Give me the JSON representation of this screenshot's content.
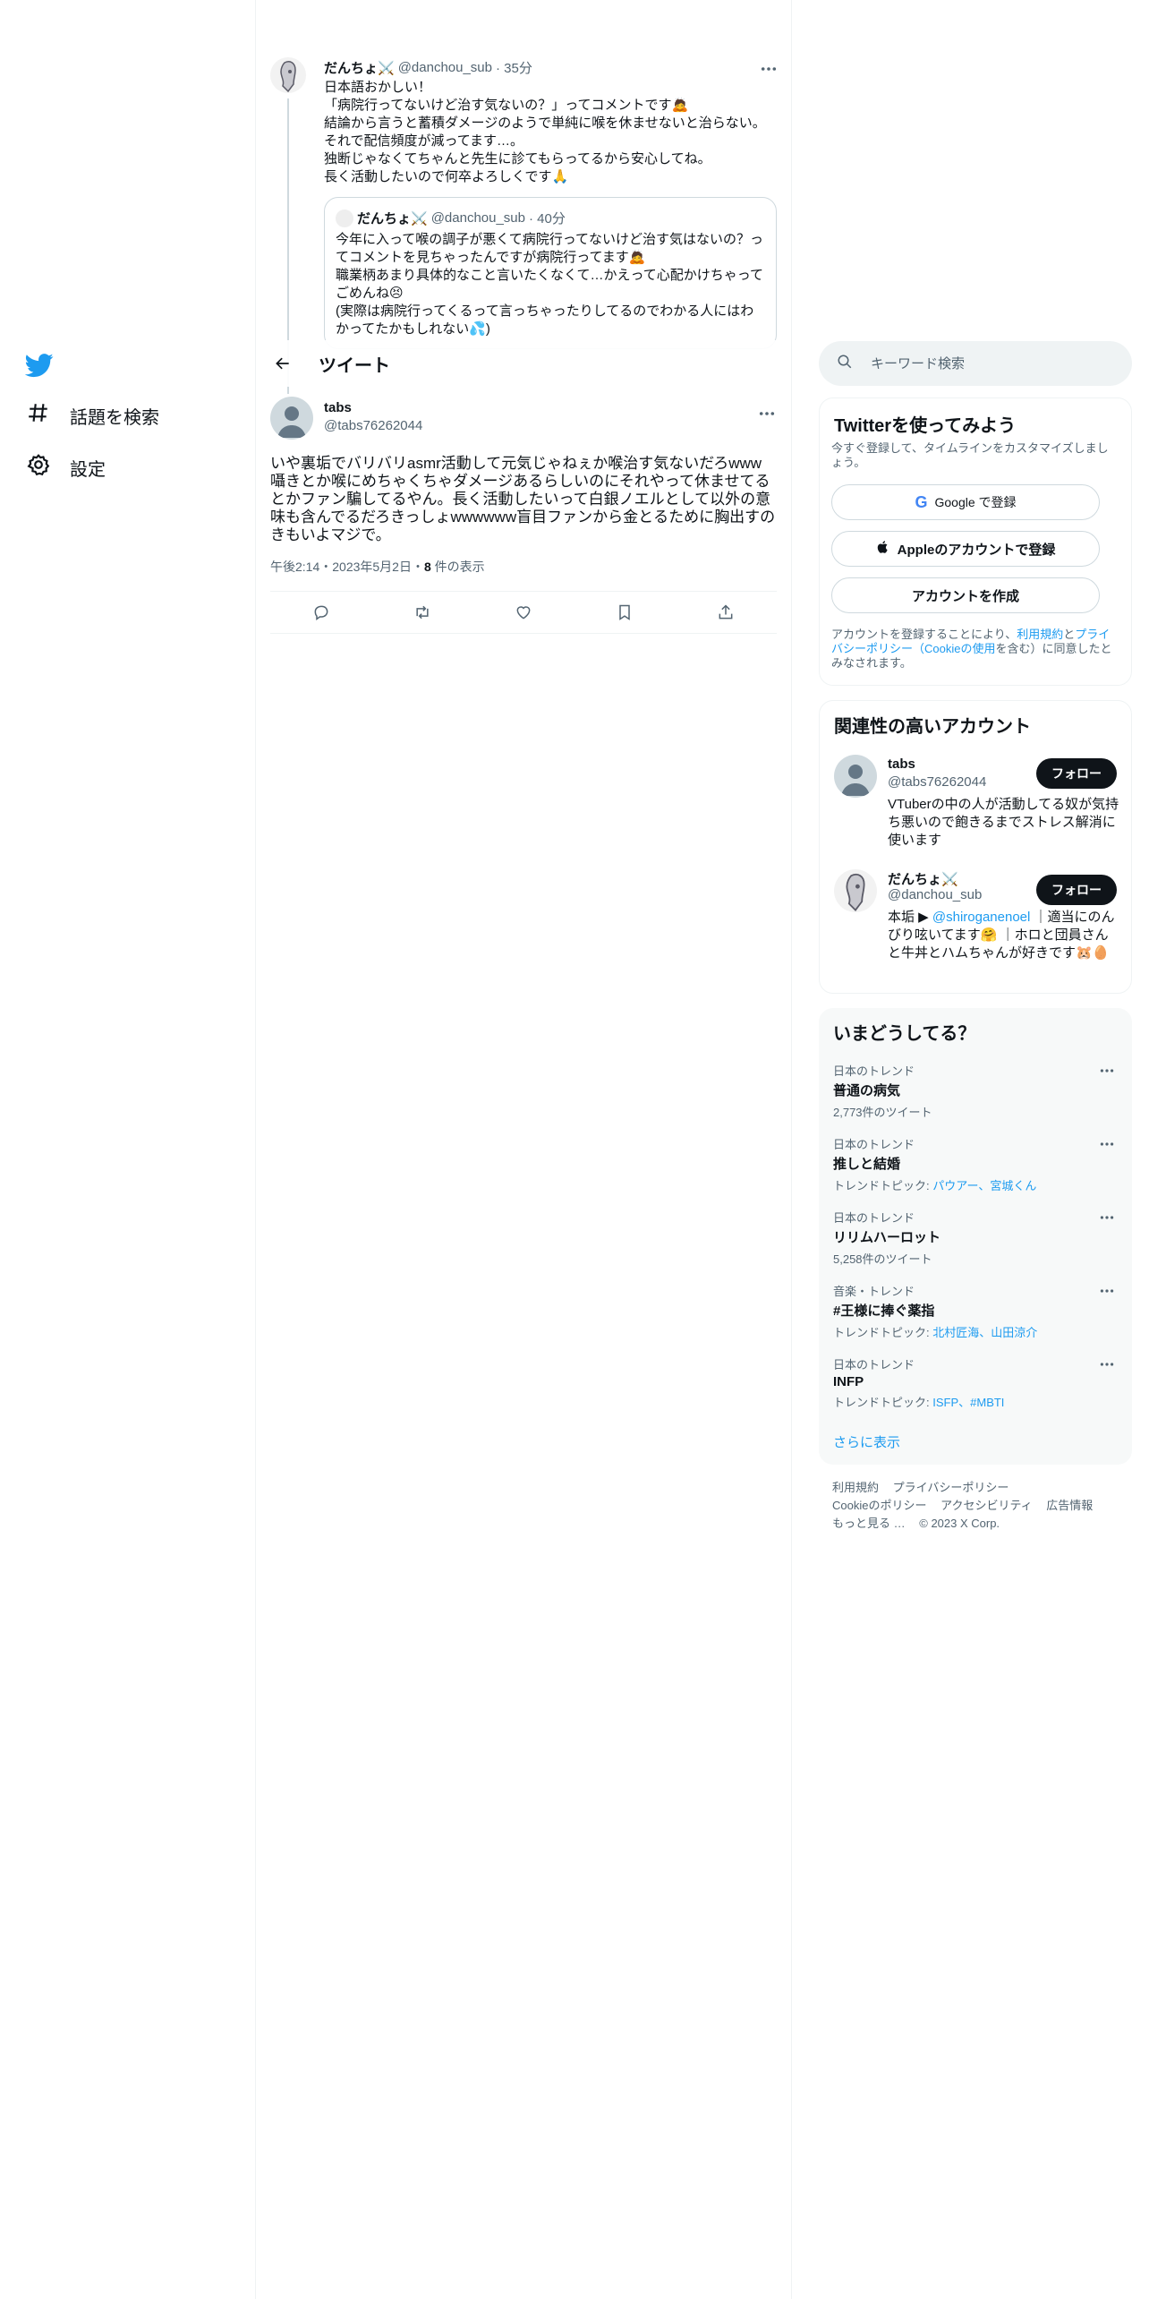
{
  "nav": {
    "items": [
      {
        "label": "話題を検索",
        "icon": "hashtag-icon"
      },
      {
        "label": "設定",
        "icon": "gear-icon"
      }
    ]
  },
  "parent_tweet": {
    "name": "だんちょ⚔️",
    "handle": "@danchou_sub",
    "time": "· 35分",
    "lines": [
      "日本語おかしい！",
      "「病院行ってないけど治す気ないの？」ってコメントです🙇",
      "結論から言うと蓄積ダメージのようで単純に喉を休ませないと治らない。",
      "それで配信頻度が減ってます…。",
      "独断じゃなくてちゃんと先生に診てもらってるから安心してね。",
      "長く活動したいので何卒よろしくです🙏"
    ],
    "quote": {
      "name": "だんちょ⚔️",
      "handle": "@danchou_sub",
      "time": "· 40分",
      "lines": [
        "今年に入って喉の調子が悪くて病院行ってないけど治す気はないの？っ",
        "てコメントを見ちゃったんですが病院行ってます🙇",
        "職業柄あまり具体的なこと言いたくなくて…かえって心配かけちゃって",
        "ごめんね😣",
        "(実際は病院行ってくるって言っちゃったりしてるのでわかる人にはわ",
        "かってたかもしれない💦)"
      ]
    }
  },
  "header": {
    "title": "ツイート"
  },
  "main_tweet": {
    "name": "tabs",
    "handle": "@tabs76262044",
    "text": "いや裏垢でバリバリasmr活動して元気じゃねぇか喉治す気ないだろwww囁きとか喉にめちゃくちゃダメージあるらしいのにそれやって休ませてるとかファン騙してるやん。長く活動したいって白銀ノエルとして以外の意味も含んでるだろきっしょwwwwww盲目ファンから金とるために胸出すのきもいよマジで。",
    "timestamp": "午後2:14・2023年5月2日・",
    "views_count": "8",
    "views_label": " 件の表示"
  },
  "search": {
    "placeholder": "キーワード検索"
  },
  "signup": {
    "title": "Twitterを使ってみよう",
    "subtitle": "今すぐ登録して、タイムラインをカスタマイズしましょう。",
    "google_label": "Google で登録",
    "apple_label": "Appleのアカウントで登録",
    "create_label": "アカウントを作成",
    "legal_prefix": "アカウントを登録することにより、",
    "legal_terms": "利用規約",
    "legal_and": "と",
    "legal_privacy": "プライバシーポリシー",
    "legal_open": "（",
    "legal_cookie": "Cookieの使用",
    "legal_suffix": "を含む）に同意したとみなされます。"
  },
  "related": {
    "title": "関連性の高いアカウント",
    "accounts": [
      {
        "name": "tabs",
        "handle": "@tabs76262044",
        "follow": "フォロー",
        "bio": "VTuberの中の人が活動してる奴が気持ち悪いので飽きるまでストレス解消に使います"
      },
      {
        "name": "だんちょ⚔️",
        "handle": "@danchou_sub",
        "follow": "フォロー",
        "bio_prefix": "本垢 ▶ ",
        "bio_mention": "@shiroganenoel",
        "bio_suffix": " ｜適当にのんびり呟いてます🤗 ｜ホロと団員さんと牛丼とハムちゃんが好きです🐹🥚"
      }
    ]
  },
  "trends": {
    "title": "いまどうしてる？",
    "items": [
      {
        "category": "日本のトレンド",
        "name": "普通の病気",
        "meta": "2,773件のツイート",
        "topics": ""
      },
      {
        "category": "日本のトレンド",
        "name": "推しと結婚",
        "meta": "トレンドトピック: ",
        "topics": "パウアー、宮城くん"
      },
      {
        "category": "日本のトレンド",
        "name": "リリムハーロット",
        "meta": "5,258件のツイート",
        "topics": ""
      },
      {
        "category": "音楽・トレンド",
        "name": "#王様に捧ぐ薬指",
        "meta": "トレンドトピック: ",
        "topics": "北村匠海、山田涼介"
      },
      {
        "category": "日本のトレンド",
        "name": "INFP",
        "meta": "トレンドトピック: ",
        "topics": "ISFP、#MBTI"
      }
    ],
    "show_more": "さらに表示"
  },
  "footer": {
    "links": [
      "利用規約",
      "プライバシーポリシー",
      "Cookieのポリシー",
      "アクセシビリティ",
      "広告情報",
      "もっと見る …"
    ],
    "copyright": "© 2023 X Corp."
  },
  "colors": {
    "accent": "#1d9bf0",
    "text": "#0f1419",
    "muted": "#536471",
    "border": "#eff3f4",
    "follow_bg": "#0f1419"
  }
}
